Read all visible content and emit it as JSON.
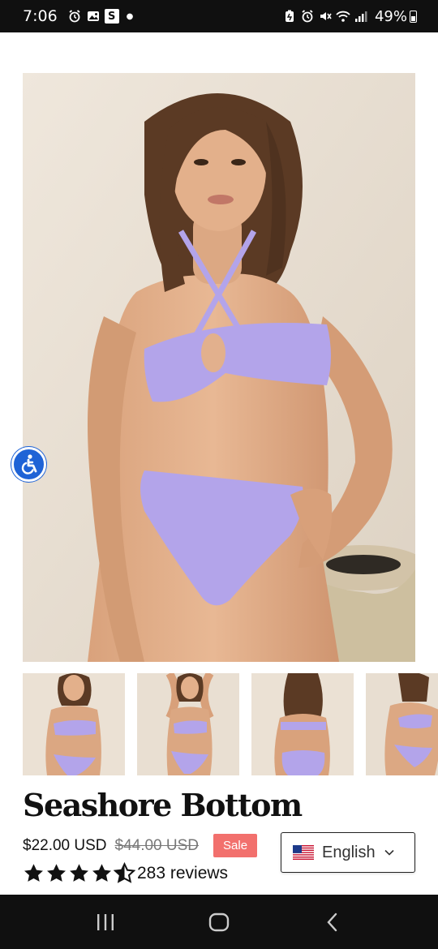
{
  "status_bar": {
    "time": "7:06",
    "left_icons": [
      "alarm-icon",
      "gallery-icon",
      "s-app-icon",
      "dot-icon"
    ],
    "s_badge": "S",
    "right_icons": [
      "battery-saver-icon",
      "alarm-icon",
      "mute-icon",
      "wifi-icon",
      "signal-icon"
    ],
    "battery_percent": "49%"
  },
  "product": {
    "title": "Seashore Bottom",
    "price": "$22.00 USD",
    "compare_price": "$44.00 USD",
    "badge": "Sale",
    "rating": 4.5,
    "reviews_label": "283 reviews"
  },
  "language_selector": {
    "label": "English",
    "flag": "us-flag-icon"
  },
  "accessibility": {
    "icon": "wheelchair-icon",
    "color": "#1f63d6"
  },
  "colors": {
    "bikini": "#b3a4ea",
    "sale_badge": "#f2706d",
    "background": "#ffffff",
    "system_bars": "#101010"
  },
  "nav_bar": {
    "buttons": [
      "recents-icon",
      "home-icon",
      "back-icon"
    ]
  }
}
